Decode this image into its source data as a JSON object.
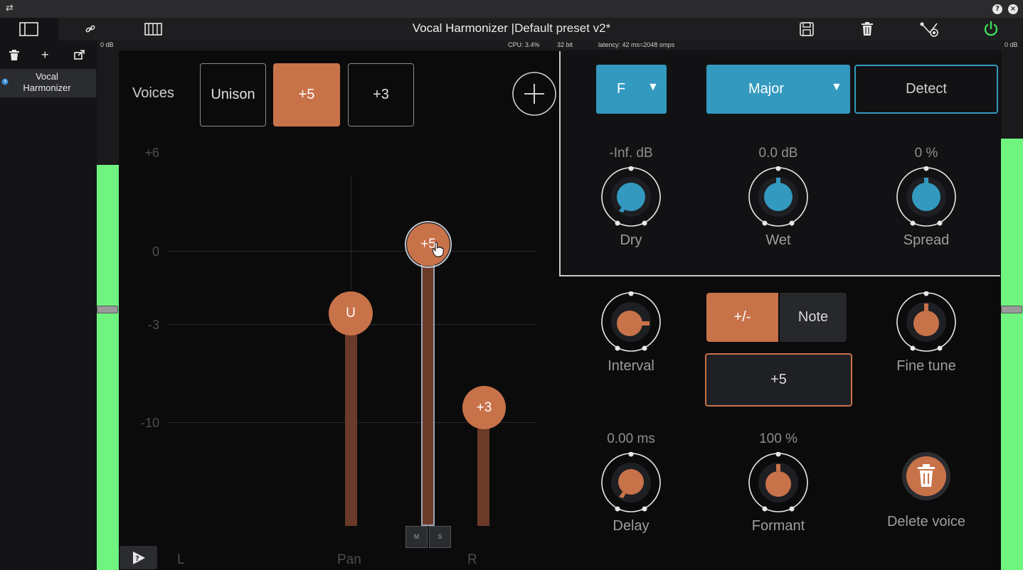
{
  "app": {
    "title": "Vocal Harmonizer |",
    "preset": "Default preset v2*"
  },
  "titlebar": {
    "help_icon": "?",
    "close_icon": "×"
  },
  "meterbar": {
    "left_db": "0 dB",
    "cpu": "CPU: 3.4%",
    "bit": "32 bit",
    "latency": "latency: 42 ms=2048 smps",
    "right_db": "0 dB"
  },
  "meters": {
    "left_level": 0.78,
    "right_level": 0.83
  },
  "sidebar": {
    "plugin_name": "Vocal Harmonizer"
  },
  "voices": {
    "label": "Voices",
    "buttons": [
      "Unison",
      "+5",
      "+3"
    ],
    "active_index": 1
  },
  "mixer": {
    "scale_labels": [
      "+6",
      "0",
      "-3",
      "-10"
    ],
    "faders": [
      {
        "label": "U",
        "db": -3
      },
      {
        "label": "+5",
        "db": 0
      },
      {
        "label": "+3",
        "db": -10
      }
    ],
    "mute_label": "M",
    "solo_label": "S",
    "pan_left": "L",
    "pan_center": "Pan",
    "pan_right": "R"
  },
  "key": {
    "note": "F",
    "scale": "Major",
    "detect_label": "Detect"
  },
  "knobs_top": [
    {
      "value": "-Inf. dB",
      "label": "Dry"
    },
    {
      "value": "0.0 dB",
      "label": "Wet"
    },
    {
      "value": "0 %",
      "label": "Spread"
    }
  ],
  "voice_controls": {
    "interval_label": "Interval",
    "mode_toggle": [
      "+/-",
      "Note"
    ],
    "interval_value": "+5",
    "fine_tune_label": "Fine tune",
    "delay_value": "0.00 ms",
    "delay_label": "Delay",
    "formant_value": "100 %",
    "formant_label": "Formant",
    "delete_label": "Delete voice"
  },
  "colors": {
    "accent_orange": "#c8724a",
    "accent_blue": "#3399bf",
    "meter_green": "#6ff57f",
    "power_green": "#3ddc5a"
  }
}
